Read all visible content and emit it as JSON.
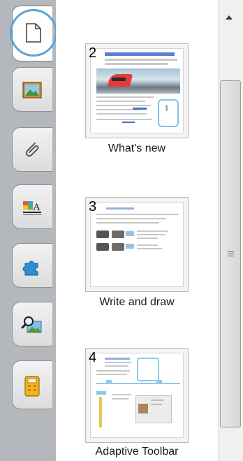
{
  "tabs": {
    "items": [
      {
        "name": "page-sorter-tab",
        "icon": "page-icon"
      },
      {
        "name": "gallery-tab",
        "icon": "picture-icon"
      },
      {
        "name": "attachments-tab",
        "icon": "paperclip-icon"
      },
      {
        "name": "properties-tab",
        "icon": "properties-icon"
      },
      {
        "name": "addons-tab",
        "icon": "puzzle-icon"
      },
      {
        "name": "lesson-activity-tab",
        "icon": "search-image-icon"
      },
      {
        "name": "response-tab",
        "icon": "clicker-icon"
      }
    ]
  },
  "pages": [
    {
      "number": "2",
      "caption": "What's new"
    },
    {
      "number": "3",
      "caption": "Write and draw"
    },
    {
      "number": "4",
      "caption": "Adaptive Toolbar"
    }
  ]
}
